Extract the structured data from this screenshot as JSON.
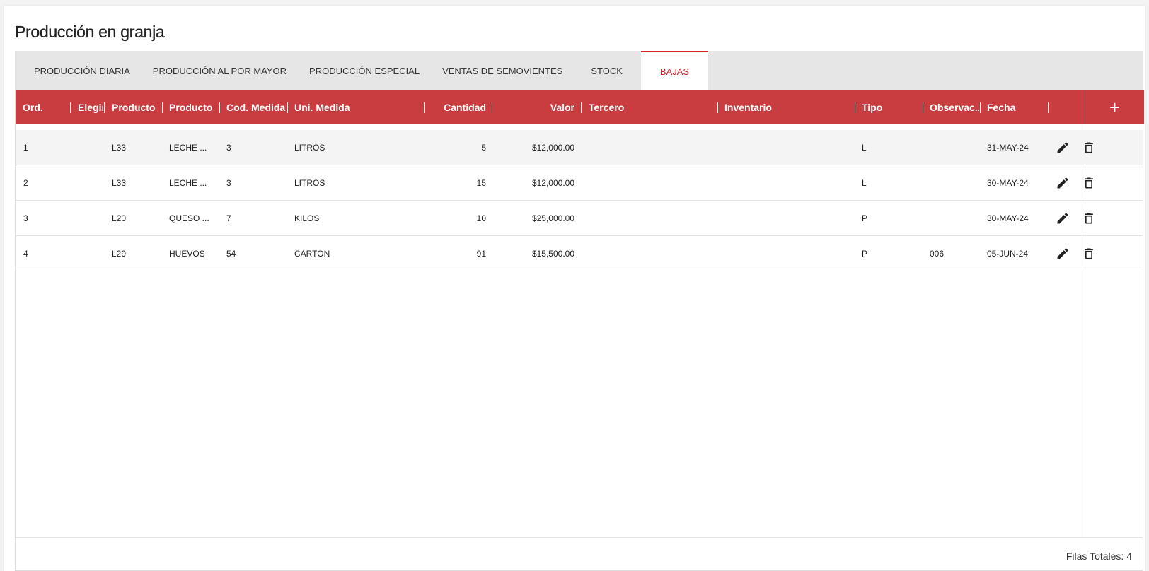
{
  "page": {
    "title": "Producción en granja"
  },
  "tabs": [
    {
      "label": "PRODUCCIÓN DIARIA"
    },
    {
      "label": "PRODUCCIÓN AL POR MAYOR"
    },
    {
      "label": "PRODUCCIÓN ESPECIAL"
    },
    {
      "label": "VENTAS DE SEMOVIENTES"
    },
    {
      "label": "STOCK"
    },
    {
      "label": "BAJAS",
      "active": true
    }
  ],
  "grid": {
    "columns": {
      "ord": "Ord.",
      "elegir": "Elegir",
      "producto_cod": "Producto",
      "producto_nombre": "Producto",
      "cod_medida": "Cod. Medida",
      "uni_medida": "Uni. Medida",
      "cantidad": "Cantidad",
      "valor": "Valor",
      "tercero": "Tercero",
      "inventario": "Inventario",
      "tipo": "Tipo",
      "observaciones": "Observac...",
      "fecha": "Fecha"
    },
    "add_icon": "plus-icon",
    "rows": [
      {
        "ord": "1",
        "elegir": "",
        "producto_cod": "L33",
        "producto_nombre": "LECHE ...",
        "cod_medida": "3",
        "uni_medida": "LITROS",
        "cantidad": "5",
        "valor": "$12,000.00",
        "tercero": "",
        "inventario": "",
        "tipo": "L",
        "observaciones": "",
        "fecha": "31-MAY-24"
      },
      {
        "ord": "2",
        "elegir": "",
        "producto_cod": "L33",
        "producto_nombre": "LECHE ...",
        "cod_medida": "3",
        "uni_medida": "LITROS",
        "cantidad": "15",
        "valor": "$12,000.00",
        "tercero": "",
        "inventario": "",
        "tipo": "L",
        "observaciones": "",
        "fecha": "30-MAY-24"
      },
      {
        "ord": "3",
        "elegir": "",
        "producto_cod": "L20",
        "producto_nombre": "QUESO ...",
        "cod_medida": "7",
        "uni_medida": "KILOS",
        "cantidad": "10",
        "valor": "$25,000.00",
        "tercero": "",
        "inventario": "",
        "tipo": "P",
        "observaciones": "",
        "fecha": "30-MAY-24"
      },
      {
        "ord": "4",
        "elegir": "",
        "producto_cod": "L29",
        "producto_nombre": "HUEVOS",
        "cod_medida": "54",
        "uni_medida": "CARTON",
        "cantidad": "91",
        "valor": "$15,500.00",
        "tercero": "",
        "inventario": "",
        "tipo": "P",
        "observaciones": "006",
        "fecha": "05-JUN-24"
      }
    ],
    "row_icons": {
      "edit": "pencil-icon",
      "delete": "trash-icon"
    },
    "footer": {
      "total_rows": "Filas Totales: 4"
    }
  },
  "colors": {
    "accent": "#d9202b",
    "header_bg": "#c93c3f",
    "tab_bar_bg": "#e6e6e6",
    "alt_row_bg": "#f4f4f4"
  }
}
